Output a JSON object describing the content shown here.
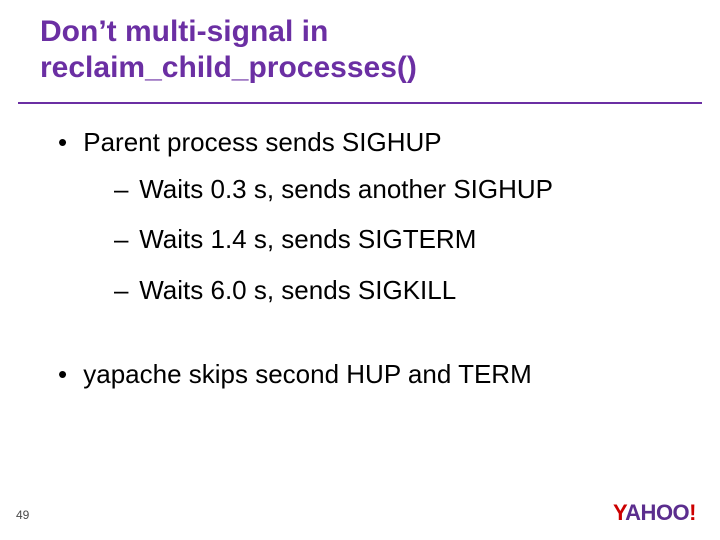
{
  "title": {
    "line1": "Don’t multi-signal in",
    "line2": "reclaim_child_processes()"
  },
  "bullets": {
    "b1": "Parent process sends SIGHUP",
    "sub": [
      "Waits 0.3 s, sends another SIGHUP",
      "Waits 1.4 s, sends SIGTERM",
      "Waits 6.0 s, sends SIGKILL"
    ],
    "b2": "yapache skips second HUP and TERM"
  },
  "page_number": "49",
  "logo": {
    "part1": "Y",
    "part2": "AHOO",
    "bang": "!"
  }
}
